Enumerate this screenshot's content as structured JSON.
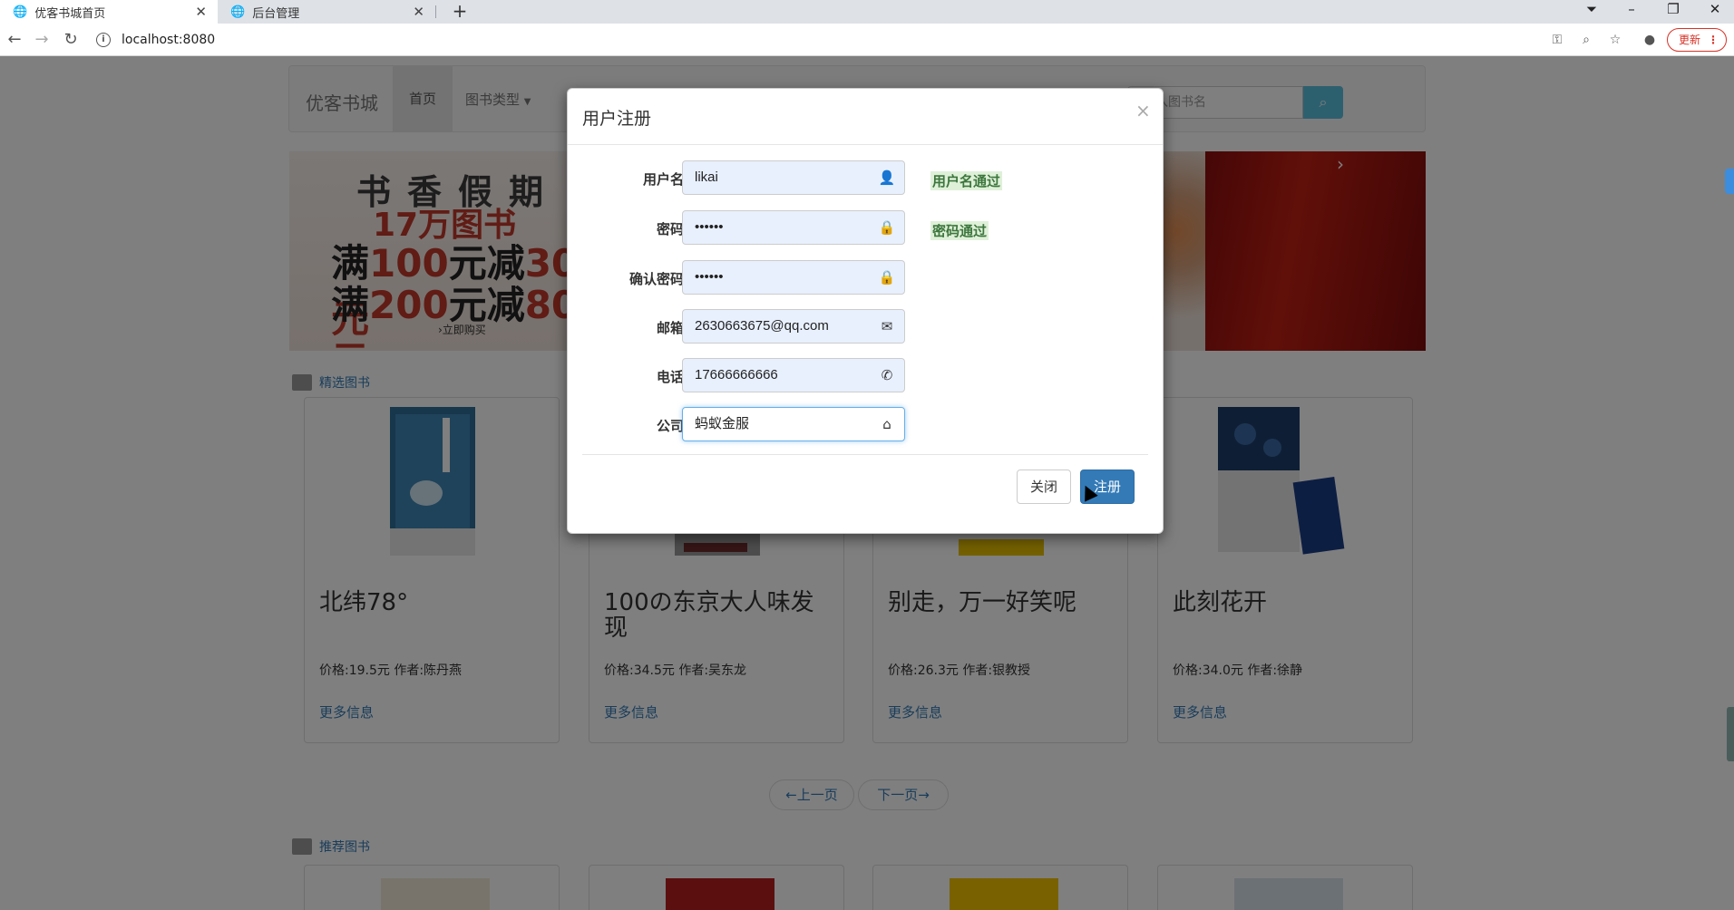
{
  "browser": {
    "tabs": [
      {
        "title": "优客书城首页",
        "active": true
      },
      {
        "title": "后台管理",
        "active": false
      }
    ],
    "url": "localhost:8080",
    "update_label": "更新"
  },
  "navbar": {
    "brand": "优客书城",
    "home": "首页",
    "book_type": "图书类型",
    "search_placeholder": "入图书名"
  },
  "banner": {
    "line1": "书香假期",
    "line2": "17万图书",
    "line3_pre": "满",
    "line3_num": "100",
    "line3_post": "元减",
    "line3_num2": "30",
    "line3_end": "元",
    "line4_pre": "满",
    "line4_num": "200",
    "line4_post": "元减",
    "line4_num2": "80",
    "line4_end": "元",
    "line5": "›立即购买"
  },
  "featured": {
    "section_title": "精选图书",
    "books": [
      {
        "title": "北纬78°",
        "meta": "价格:19.5元   作者:陈丹燕",
        "more": "更多信息"
      },
      {
        "title": "100の东京大人味发现",
        "meta": "价格:34.5元   作者:吴东龙",
        "more": "更多信息"
      },
      {
        "title": "别走，万一好笑呢",
        "meta": "价格:26.3元   作者:银教授",
        "more": "更多信息"
      },
      {
        "title": "此刻花开",
        "meta": "价格:34.0元   作者:徐静",
        "more": "更多信息"
      }
    ],
    "prev": "←上一页",
    "next": "下一页→"
  },
  "recommended": {
    "section_title": "推荐图书"
  },
  "modal": {
    "title": "用户注册",
    "close_x": "×",
    "fields": [
      {
        "label": "用户名",
        "value": "likai",
        "icon": "user-icon",
        "hint": "用户名通过"
      },
      {
        "label": "密码",
        "value": "••••••",
        "icon": "lock-icon",
        "hint": "密码通过"
      },
      {
        "label": "确认密码",
        "value": "••••••",
        "icon": "lock-icon",
        "hint": ""
      },
      {
        "label": "邮箱",
        "value": "2630663675@qq.com",
        "icon": "envelope-icon",
        "hint": ""
      },
      {
        "label": "电话",
        "value": "17666666666",
        "icon": "phone-icon",
        "hint": ""
      },
      {
        "label": "公司",
        "value": "蚂蚁金服",
        "icon": "home-icon",
        "hint": ""
      }
    ],
    "close_label": "关闭",
    "register_label": "注册"
  },
  "colors": {
    "primary": "#337ab7",
    "info": "#5bc0de",
    "success_text": "#3c763d",
    "success_bg": "#dff0d8"
  }
}
